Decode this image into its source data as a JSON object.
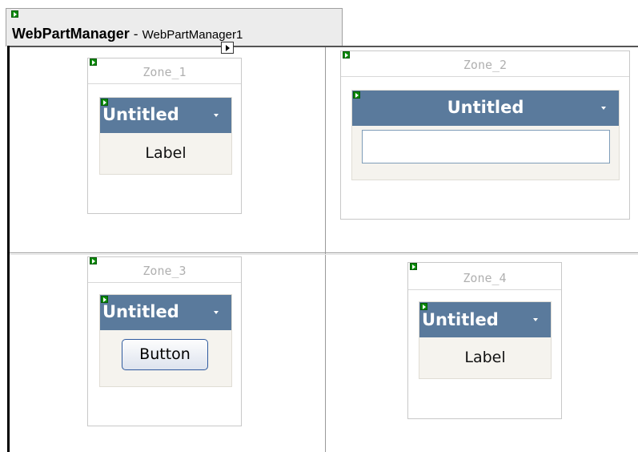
{
  "web_part_manager": {
    "type_name": "WebPartManager",
    "separator": " - ",
    "id": "WebPartManager1",
    "chevron_icon": "smart-tag-arrow"
  },
  "zones": [
    {
      "title": "Zone_1",
      "web_part": {
        "title": "Untitled",
        "content_type": "label",
        "content": "Label"
      }
    },
    {
      "title": "Zone_2",
      "web_part": {
        "title": "Untitled",
        "content_type": "textbox",
        "content": ""
      }
    },
    {
      "title": "Zone_3",
      "web_part": {
        "title": "Untitled",
        "content_type": "button",
        "content": "Button"
      }
    },
    {
      "title": "Zone_4",
      "web_part": {
        "title": "Untitled",
        "content_type": "label",
        "content": "Label"
      }
    }
  ],
  "colors": {
    "web_part_header": "#5a7a9c",
    "web_part_body": "#f5f3ee",
    "zone_title_text": "#b0b0b0",
    "design_glyph": "#0a8a0a"
  },
  "icons": {
    "design_glyph": "green-arrow-glyph-icon",
    "verbs_menu": "dropdown-arrow-icon"
  }
}
